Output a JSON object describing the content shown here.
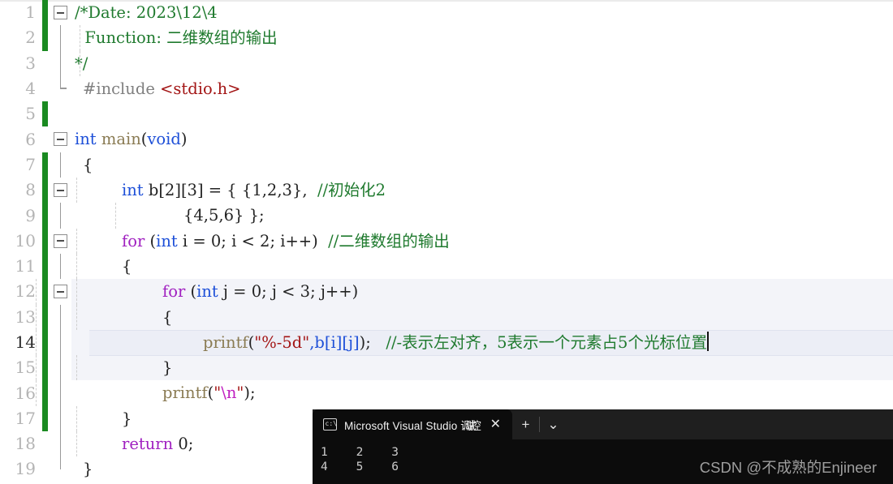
{
  "editor": {
    "lines": [
      {
        "num": "1",
        "change": true,
        "fold": "open",
        "indent": 0,
        "current": false
      },
      {
        "num": "2",
        "change": true,
        "fold": "line",
        "indent": 1,
        "current": false
      },
      {
        "num": "3",
        "change": false,
        "fold": "end",
        "indent": 0,
        "current": false
      },
      {
        "num": "4",
        "change": false,
        "fold": "none",
        "indent": 0,
        "current": false
      },
      {
        "num": "5",
        "change": true,
        "fold": "none",
        "indent": 0,
        "current": false
      },
      {
        "num": "6",
        "change": false,
        "fold": "open",
        "indent": 0,
        "current": false
      },
      {
        "num": "7",
        "change": true,
        "fold": "line",
        "indent": 0,
        "current": false
      },
      {
        "num": "8",
        "change": true,
        "fold": "open",
        "indent": 1,
        "current": false
      },
      {
        "num": "9",
        "change": true,
        "fold": "line",
        "indent": 1,
        "current": false
      },
      {
        "num": "10",
        "change": true,
        "fold": "open",
        "indent": 1,
        "current": false
      },
      {
        "num": "11",
        "change": true,
        "fold": "line",
        "indent": 1,
        "current": false
      },
      {
        "num": "12",
        "change": true,
        "fold": "open",
        "indent": 2,
        "current": false
      },
      {
        "num": "13",
        "change": true,
        "fold": "line",
        "indent": 2,
        "current": false
      },
      {
        "num": "14",
        "change": true,
        "fold": "line",
        "indent": 2,
        "current": true
      },
      {
        "num": "15",
        "change": true,
        "fold": "line",
        "indent": 2,
        "current": false
      },
      {
        "num": "16",
        "change": true,
        "fold": "endline",
        "indent": 1,
        "current": false
      },
      {
        "num": "17",
        "change": true,
        "fold": "line",
        "indent": 1,
        "current": false
      },
      {
        "num": "18",
        "change": false,
        "fold": "line",
        "indent": 1,
        "current": false
      },
      {
        "num": "19",
        "change": false,
        "fold": "end",
        "indent": 0,
        "current": false
      }
    ],
    "code": {
      "l1_comment": "/*Date: 2023\\12\\4",
      "l2_comment": "  Function: 二维数组的输出",
      "l3_comment": "*/",
      "l4_pp": "#include ",
      "l4_header": "<stdio.h>",
      "l5": "",
      "l6_type": "int",
      "l6_fn": " main",
      "l6_paren_open": "(",
      "l6_void": "void",
      "l6_paren_close": ")",
      "l7_brace": "{",
      "l8_type": "int",
      "l8_rest": " b[2][3] = { {1,2,3},  ",
      "l8_comment": "//初始化2",
      "l9": "                    {4,5,6} };",
      "l10_kw": "for",
      "l10_open": " (",
      "l10_type": "int",
      "l10_rest": " i = 0; i < 2; i++)  ",
      "l10_comment": "//二维数组的输出",
      "l11_brace": "{",
      "l12_kw": "for",
      "l12_open": " (",
      "l12_type": "int",
      "l12_rest": " j = 0; j < 3; j++)",
      "l13_brace": "{",
      "l14_fn": "printf",
      "l14_open": "(",
      "l14_str": "\"%-5d\"",
      "l14_mid": ",b[i][j]",
      "l14_close": ");",
      "l14_gap": "   ",
      "l14_comment": "//-表示左对齐，5表示一个元素占5个光标位置",
      "l15_brace": "}",
      "l16_fn": "printf",
      "l16_open": "(",
      "l16_quote_open": "\"",
      "l16_esc": "\\n",
      "l16_quote_close": "\"",
      "l16_close": ");",
      "l17_brace": "}",
      "l18_kw": "return",
      "l18_rest": " 0;",
      "l19_brace": "}"
    }
  },
  "terminal": {
    "tab_title_ascii": "Microsoft Visual Studio ",
    "tab_title_cjk": "调试控",
    "close_label": "✕",
    "newtab_label": "+",
    "dropdown_label": "⌄",
    "output_line1": "1    2    3",
    "output_line2": "4    5    6"
  },
  "watermark": {
    "text": "CSDN @不成熟的Enjineer"
  },
  "colors": {
    "keyword": "#a020c0",
    "type": "#1d4fd8",
    "comment": "#1f7a2e",
    "string": "#a31515",
    "change_bar": "#1a8a21",
    "terminal_bg": "#0c0c0c",
    "current_line": "#eceef6"
  }
}
